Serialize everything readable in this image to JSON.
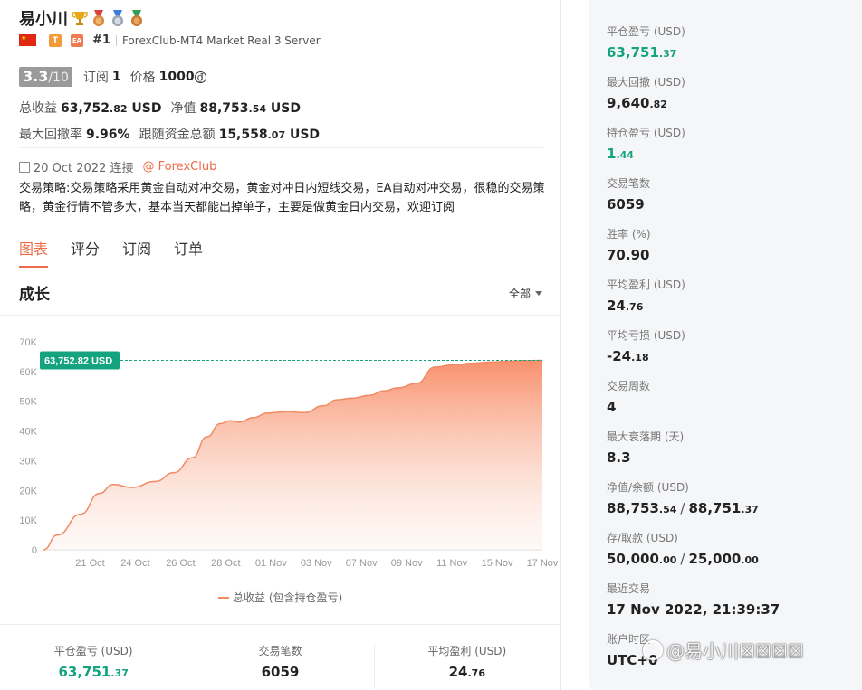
{
  "header": {
    "name": "易小川",
    "tag_t": "T",
    "tag_ea": "EA",
    "rank": "#1",
    "server": "ForexClub-MT4 Market Real 3 Server"
  },
  "rating": {
    "score": "3.3",
    "score_of": "/10",
    "subs_label": "订阅",
    "subs_value": "1",
    "price_label": "价格",
    "price_value": "1000",
    "price_icon": "₫"
  },
  "stats": {
    "total_profit_label": "总收益",
    "total_profit_int": "63,752",
    "total_profit_dec": ".82",
    "total_profit_unit": "USD",
    "net_label": "净值",
    "net_int": "88,753",
    "net_dec": ".54",
    "net_unit": "USD",
    "max_dd_label": "最大回撤率",
    "max_dd_value": "9.96%",
    "follow_label": "跟随资金总额",
    "follow_int": "15,558",
    "follow_dec": ".07",
    "follow_unit": "USD"
  },
  "connection": {
    "date": "20 Oct 2022 连接",
    "broker": "@ ForexClub"
  },
  "strategy_text": "交易策略:交易策略采用黄金自动对冲交易，黄金对冲日内短线交易，EA自动对冲交易，很稳的交易策略，黄金行情不管多大，基本当天都能出掉单子，主要是做黄金日内交易，欢迎订阅",
  "tabs": [
    "图表",
    "评分",
    "订阅",
    "订单"
  ],
  "chart_section": {
    "title": "成长",
    "filter": "全部"
  },
  "chart_data": {
    "type": "area",
    "title": "",
    "x_ticks": [
      "21 Oct",
      "24 Oct",
      "26 Oct",
      "28 Oct",
      "01 Nov",
      "03 Nov",
      "07 Nov",
      "09 Nov",
      "11 Nov",
      "15 Nov",
      "17 Nov"
    ],
    "y_ticks": [
      "0",
      "10K",
      "20K",
      "30K",
      "40K",
      "50K",
      "60K",
      "70K"
    ],
    "ylim": [
      0,
      70000
    ],
    "series": [
      {
        "name": "总收益 (包含持仓盈亏)",
        "x": [
          0,
          0.3,
          0.8,
          1.2,
          1.5,
          1.9,
          2.4,
          2.8,
          3.2,
          3.5,
          3.8,
          4.0,
          4.2,
          4.5,
          4.8,
          5.2,
          5.6,
          6.0,
          6.3,
          6.6,
          7.0,
          7.3,
          7.6,
          8.0,
          8.4,
          8.8,
          9.2,
          9.6,
          10.0,
          10.4,
          10.7
        ],
        "values": [
          0,
          5000,
          12000,
          19000,
          22000,
          21000,
          23000,
          26000,
          31000,
          38000,
          42500,
          43500,
          43000,
          44500,
          46000,
          46500,
          46200,
          48500,
          50500,
          51000,
          52000,
          53500,
          54500,
          56000,
          61500,
          62300,
          62800,
          63200,
          63500,
          63700,
          63751
        ]
      }
    ],
    "annotation": "63,752.82 USD",
    "legend_position": "bottom",
    "grid": false
  },
  "bottom_stats": [
    {
      "label": "平仓盈亏 (USD)",
      "int": "63,751",
      "dec": ".37",
      "green": true
    },
    {
      "label": "交易笔数",
      "int": "6059",
      "dec": "",
      "green": false
    },
    {
      "label": "平均盈利 (USD)",
      "int": "24",
      "dec": ".76",
      "green": false
    }
  ],
  "right_stats": [
    {
      "label": "平仓盈亏 (USD)",
      "int": "63,751",
      "dec": ".37",
      "green": true
    },
    {
      "label": "最大回撤 (USD)",
      "int": "9,640",
      "dec": ".82",
      "green": false
    },
    {
      "label": "持仓盈亏 (USD)",
      "int": "1",
      "dec": ".44",
      "green": true
    },
    {
      "label": "交易笔数",
      "int": "6059",
      "dec": "",
      "green": false
    },
    {
      "label": "胜率 (%)",
      "int": "70.90",
      "dec": "",
      "green": false
    },
    {
      "label": "平均盈利 (USD)",
      "int": "24",
      "dec": ".76",
      "green": false
    },
    {
      "label": "平均亏损 (USD)",
      "int": "-24",
      "dec": ".18",
      "green": false
    },
    {
      "label": "交易周数",
      "int": "4",
      "dec": "",
      "green": false
    },
    {
      "label": "最大衰落期 (天)",
      "int": "8.3",
      "dec": "",
      "green": false
    },
    {
      "label": "净值/余额 (USD)",
      "int": "88,753",
      "dec": ".54",
      "int2": "88,751",
      "dec2": ".37",
      "green": false
    },
    {
      "label": "存/取款 (USD)",
      "int": "50,000",
      "dec": ".00",
      "int2": "25,000",
      "dec2": ".00",
      "green": false
    },
    {
      "label": "最近交易",
      "int": "17 Nov 2022, 21:39:37",
      "dec": "",
      "green": false
    },
    {
      "label": "账户时区",
      "int": "UTC+0",
      "dec": "",
      "green": false
    }
  ],
  "watermark": "@易小川☒☒☒☒",
  "colors": {
    "accent": "#ee6b47",
    "green": "#14a37f",
    "area_fill": "#f9a285"
  }
}
